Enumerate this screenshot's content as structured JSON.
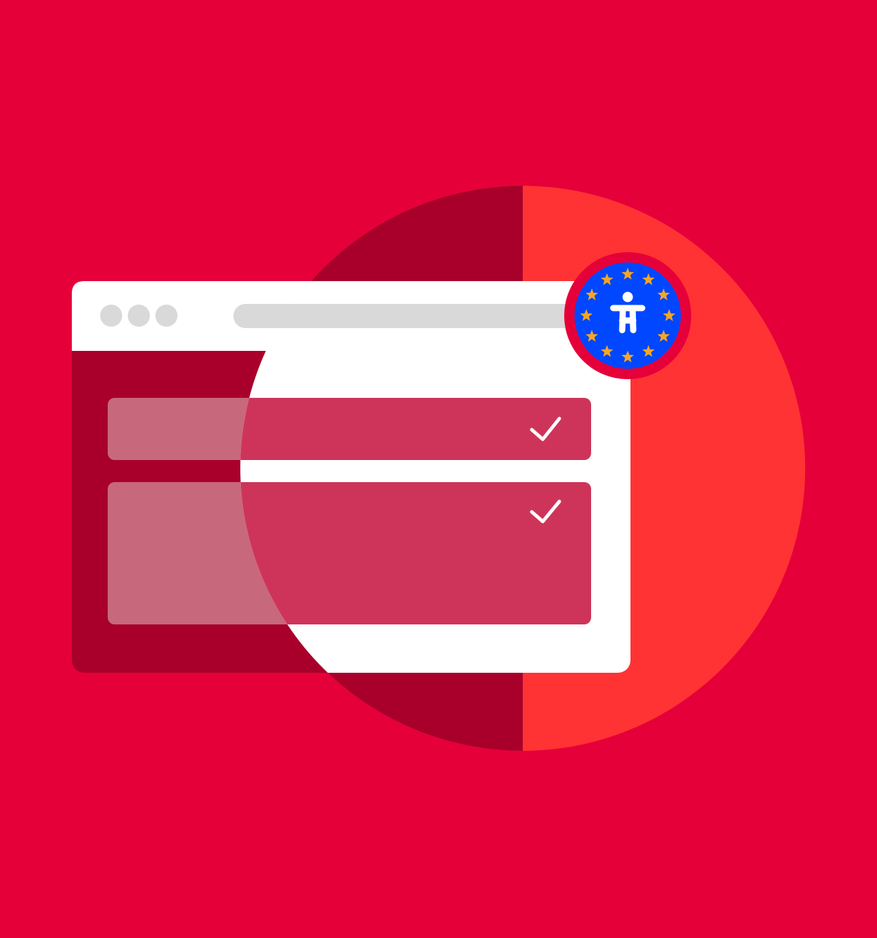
{
  "illustration": {
    "background_color": "#E6003A",
    "magnifier": {
      "left_half_color": "#A8002B",
      "right_half_color": "#FF3333"
    },
    "browser_window": {
      "frame_color": "#FFFFFF",
      "dimmed_content_color": "#A8002B",
      "window_dots": [
        "dot",
        "dot",
        "dot"
      ],
      "window_dots_color": "#D9D9D9",
      "address_bar_color": "#D9D9D9",
      "address_bar_text": ""
    },
    "content_rows": [
      {
        "status": "checked",
        "icon": "check-icon"
      },
      {
        "status": "checked",
        "icon": "check-icon"
      }
    ],
    "row_colors": {
      "dimmed": "#C8687D",
      "magnified": "#CE3459"
    },
    "badge": {
      "icon": "eu-accessibility-badge-icon",
      "inner_icon": "accessibility-person-icon",
      "background_color": "#0047FF",
      "star_color": "#F5A623",
      "star_count": 12,
      "ring_color": "#E6003A"
    }
  }
}
